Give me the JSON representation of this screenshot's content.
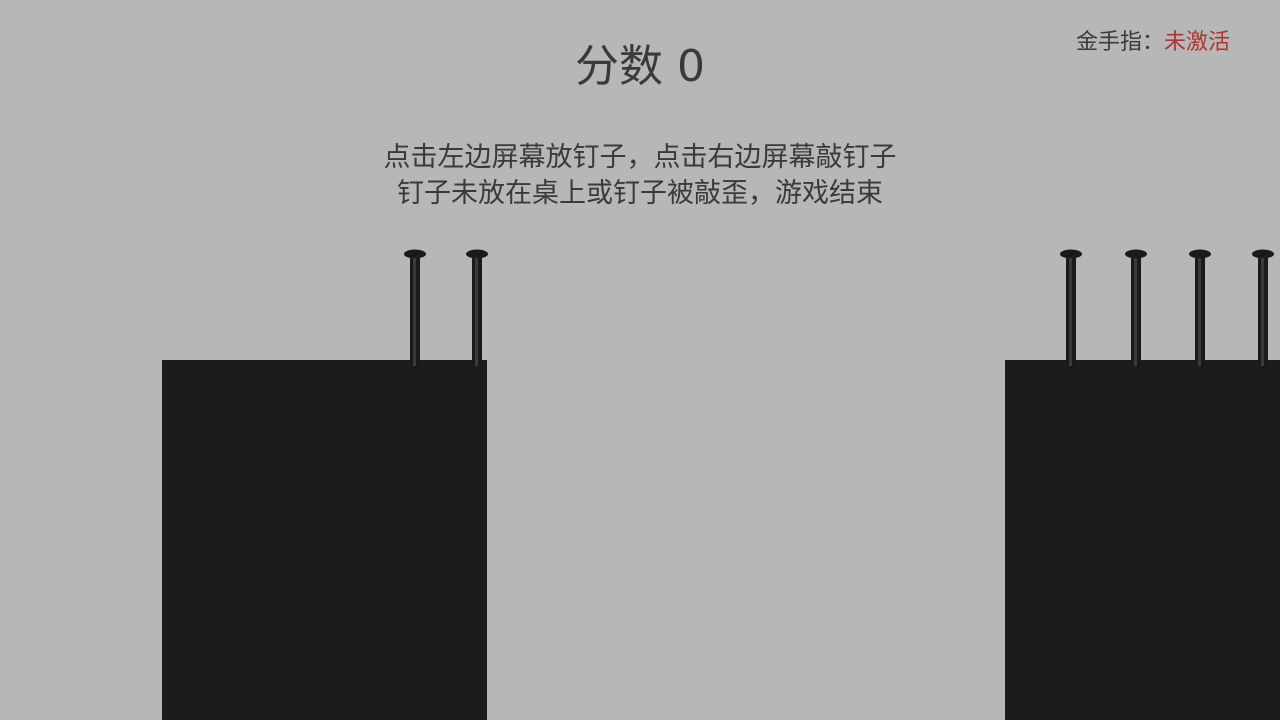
{
  "hud": {
    "score_label": "分数",
    "score_value": "0",
    "cheat_label": "金手指：",
    "cheat_status": "未激活",
    "cheat_status_color": "#b0342e"
  },
  "instructions": {
    "line1": "点击左边屏幕放钉子，点击右边屏幕敲钉子",
    "line2": "钉子未放在桌上或钉子被敲歪，游戏结束"
  },
  "colors": {
    "background": "#b7b7b7",
    "table": "#1c1c1b",
    "nail": "#1a1a1a"
  },
  "scene": {
    "left_table_nail_count": 2,
    "right_table_nail_count": 4
  }
}
